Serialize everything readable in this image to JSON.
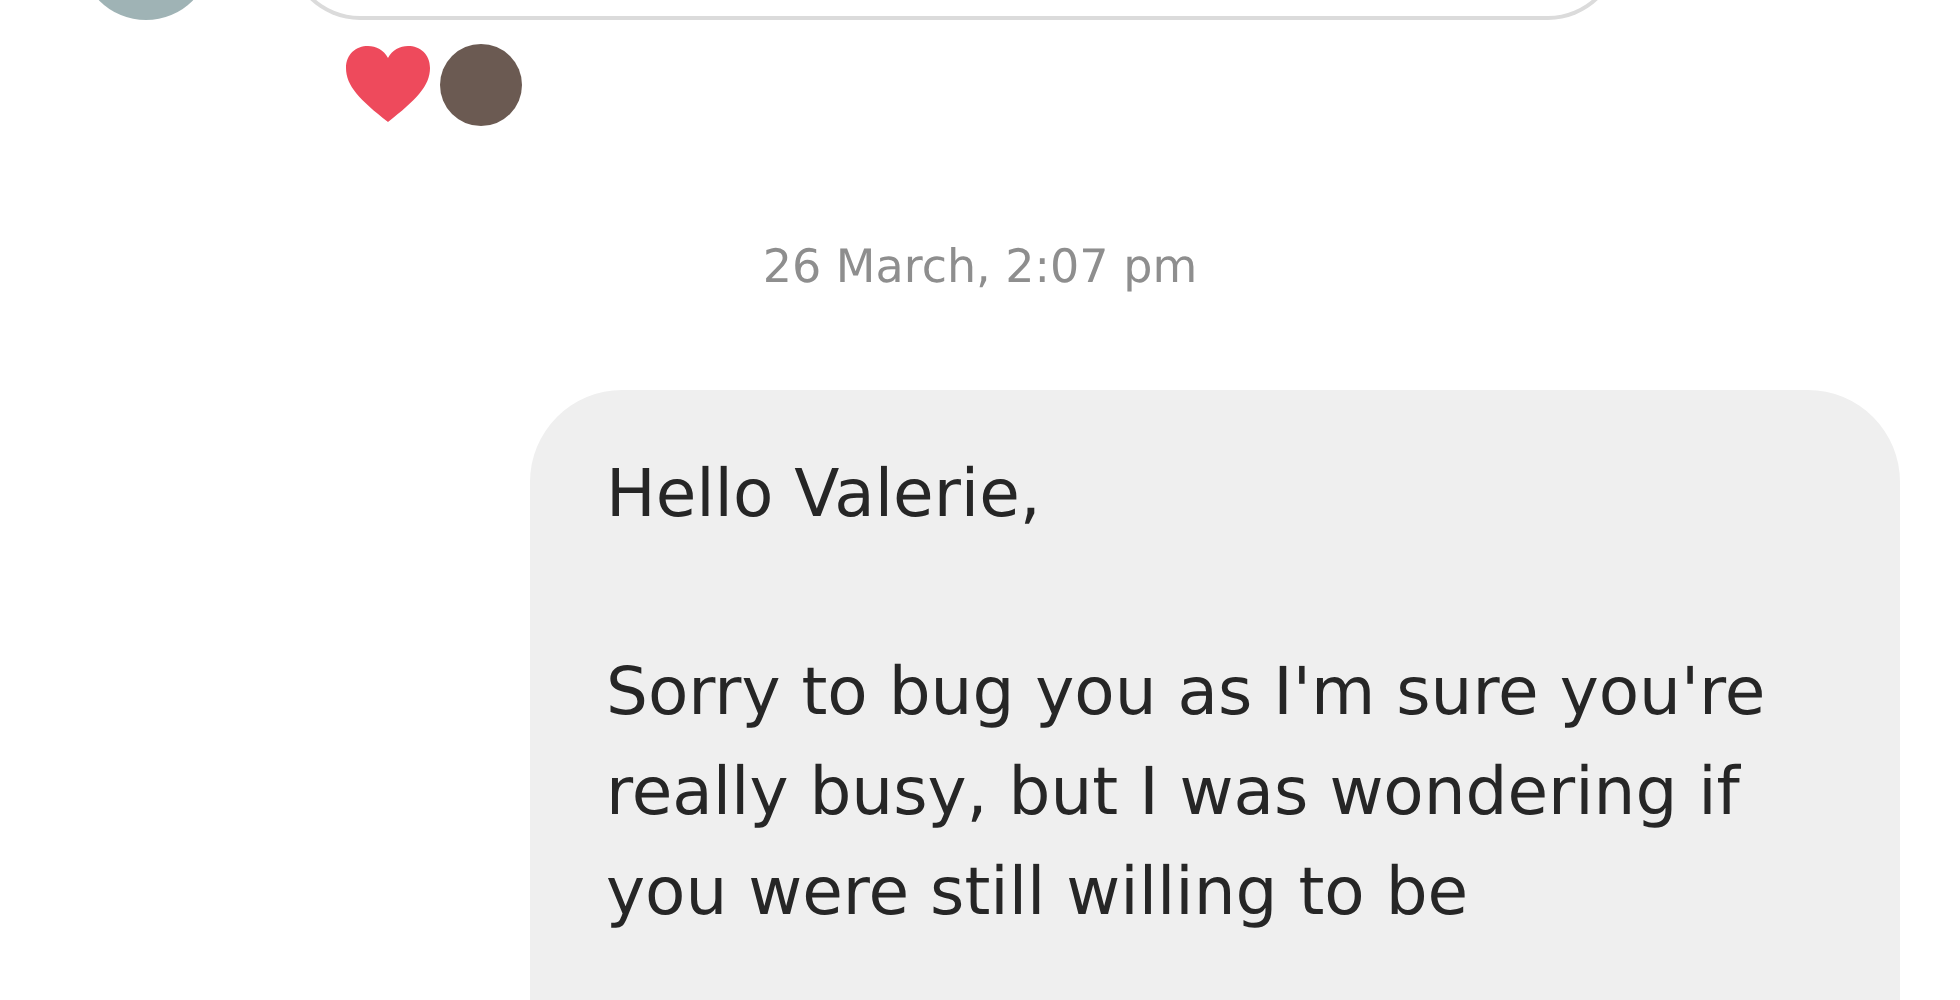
{
  "previous_message": {
    "reactions": [
      {
        "kind": "heart"
      },
      {
        "kind": "avatar"
      }
    ]
  },
  "timestamp": "26 March, 2:07 pm",
  "message": {
    "paragraphs": [
      "Hello Valerie,",
      "Sorry to bug you as I'm sure you're really busy, but I was wondering if you were still willing to be"
    ]
  }
}
